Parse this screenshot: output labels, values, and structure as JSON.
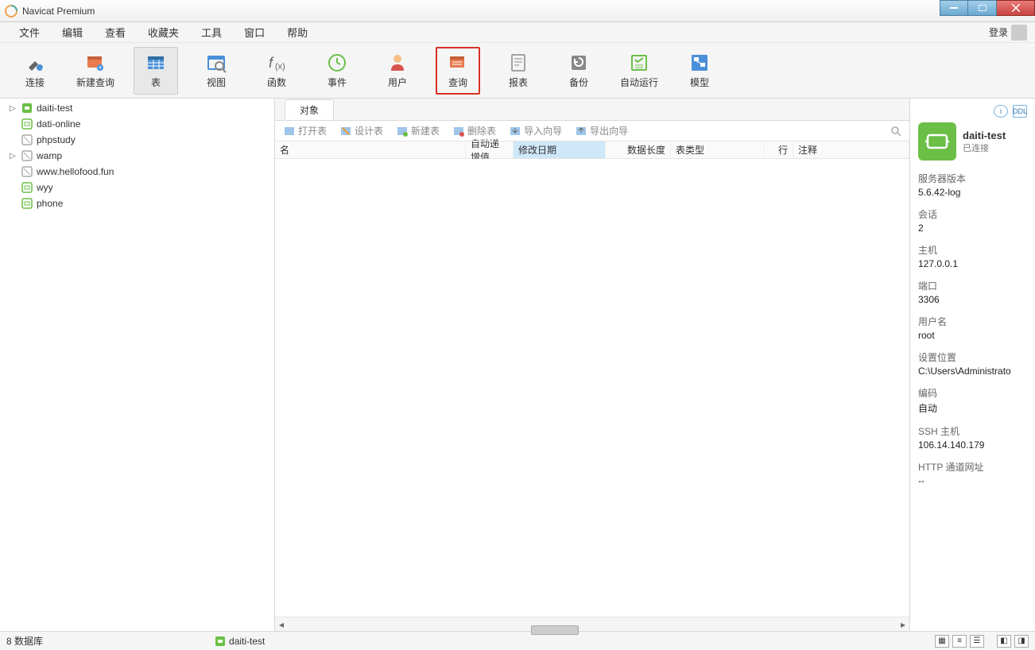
{
  "window": {
    "title": "Navicat Premium"
  },
  "menubar": {
    "items": [
      "文件",
      "编辑",
      "查看",
      "收藏夹",
      "工具",
      "窗口",
      "帮助"
    ],
    "login": "登录"
  },
  "toolbar": {
    "connect": "连接",
    "new_query": "新建查询",
    "table": "表",
    "view": "视图",
    "function": "函数",
    "event": "事件",
    "user": "用户",
    "query": "查询",
    "report": "报表",
    "backup": "备份",
    "schedule": "自动运行",
    "model": "模型"
  },
  "sidebar": {
    "items": [
      {
        "label": "daiti-test",
        "icon": "conn-open",
        "expand": true
      },
      {
        "label": "dati-online",
        "icon": "conn-closed"
      },
      {
        "label": "phpstudy",
        "icon": "conn-gray"
      },
      {
        "label": "wamp",
        "icon": "conn-gray",
        "expand": true
      },
      {
        "label": "www.hellofood.fun",
        "icon": "conn-gray"
      },
      {
        "label": "wyy",
        "icon": "conn-closed"
      },
      {
        "label": "phone",
        "icon": "conn-closed"
      }
    ]
  },
  "tabs": {
    "object": "对象"
  },
  "actions": {
    "open": "打开表",
    "design": "设计表",
    "new": "新建表",
    "delete": "删除表",
    "import": "导入向导",
    "export": "导出向导"
  },
  "columns": {
    "name": "名",
    "auto_inc": "自动递增值",
    "modify_date": "修改日期",
    "data_len": "数据长度",
    "table_type": "表类型",
    "rows": "行",
    "comment": "注释"
  },
  "details": {
    "conn_name": "daiti-test",
    "status": "已连接",
    "server_version_label": "服务器版本",
    "server_version": "5.6.42-log",
    "sessions_label": "会话",
    "sessions": "2",
    "host_label": "主机",
    "host": "127.0.0.1",
    "port_label": "端口",
    "port": "3306",
    "user_label": "用户名",
    "user": "root",
    "settings_path_label": "设置位置",
    "settings_path": "C:\\Users\\Administrato",
    "encoding_label": "编码",
    "encoding": "自动",
    "ssh_label": "SSH 主机",
    "ssh": "106.14.140.179",
    "http_label": "HTTP 通道网址",
    "http": "--"
  },
  "statusbar": {
    "db_count": "8 数据库",
    "conn": "daiti-test"
  }
}
